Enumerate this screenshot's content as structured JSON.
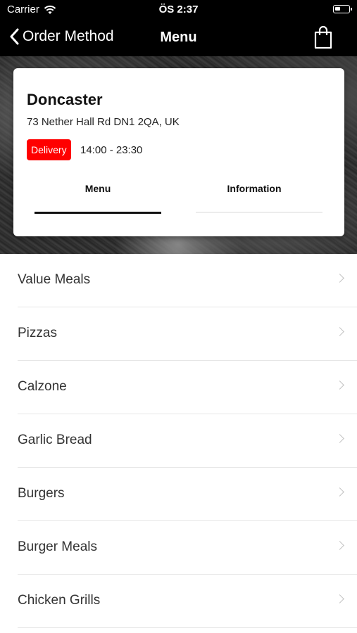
{
  "status_bar": {
    "carrier": "Carrier",
    "time": "ÖS 2:37",
    "icons": [
      "wifi-icon",
      "battery-icon"
    ]
  },
  "nav": {
    "back_label": "Order Method",
    "title": "Menu",
    "cart_icon": "shopping-bag-icon"
  },
  "store": {
    "name": "Doncaster",
    "address": "73 Nether Hall Rd DN1 2QA, UK",
    "badge": "Delivery",
    "badge_color": "#ff0000",
    "hours": "14:00 - 23:30"
  },
  "tabs": [
    {
      "label": "Menu",
      "active": true
    },
    {
      "label": "Information",
      "active": false
    }
  ],
  "menu_items": [
    {
      "label": "Value Meals"
    },
    {
      "label": "Pizzas"
    },
    {
      "label": "Calzone"
    },
    {
      "label": "Garlic Bread"
    },
    {
      "label": "Burgers"
    },
    {
      "label": "Burger Meals"
    },
    {
      "label": "Chicken Grills"
    }
  ]
}
